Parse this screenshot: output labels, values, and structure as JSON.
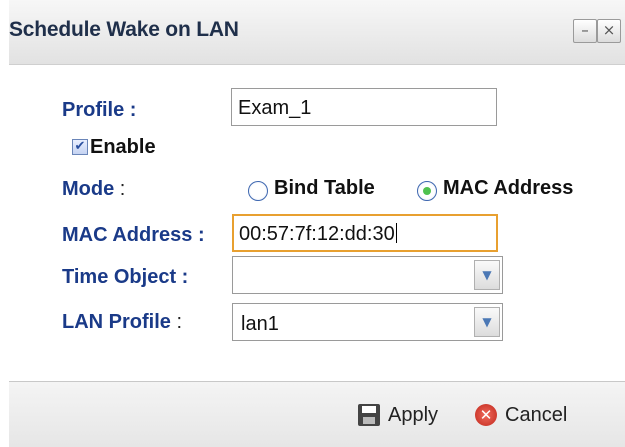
{
  "dialog": {
    "title": "Schedule Wake on LAN",
    "minimize_glyph": "–",
    "close_glyph": "×"
  },
  "form": {
    "profile": {
      "label": "Profile :",
      "value": "Exam_1"
    },
    "enable": {
      "label": "Enable",
      "checked": true,
      "check_glyph": "✔"
    },
    "mode": {
      "label": "Mode",
      "colon": ":",
      "options": [
        {
          "label": "Bind Table",
          "selected": false
        },
        {
          "label": "MAC Address",
          "selected": true
        }
      ]
    },
    "mac_address": {
      "label": "MAC Address :",
      "value": "00:57:7f:12:dd:30"
    },
    "time_object": {
      "label": "Time Object :",
      "value": ""
    },
    "lan_profile": {
      "label": "LAN Profile",
      "colon": ":",
      "value": "lan1"
    },
    "dropdown_arrow_glyph": "▼"
  },
  "footer": {
    "apply_label": "Apply",
    "cancel_label": "Cancel",
    "apply_icon": "save-icon",
    "cancel_icon": "cancel-icon",
    "cancel_glyph": "✕"
  },
  "colors": {
    "label_blue": "#1a3a88",
    "active_border": "#e8a030",
    "radio_selected": "#4fc24f"
  }
}
